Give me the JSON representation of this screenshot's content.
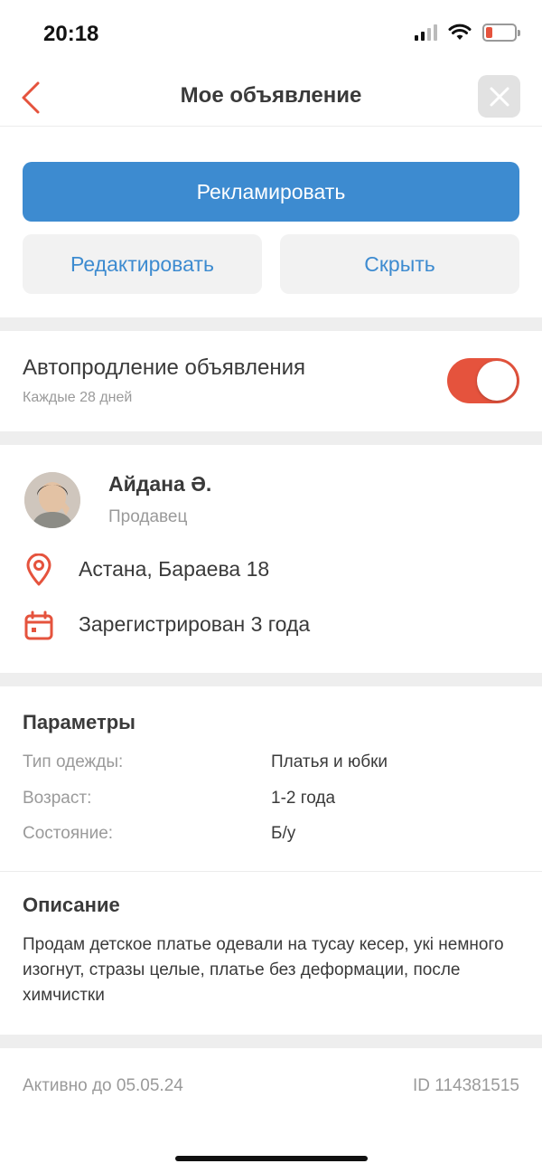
{
  "status_bar": {
    "time": "20:18"
  },
  "nav": {
    "title": "Мое объявление"
  },
  "actions": {
    "promote_label": "Рекламировать",
    "edit_label": "Редактировать",
    "hide_label": "Скрыть"
  },
  "autorenew": {
    "title": "Автопродление объявления",
    "subtitle": "Каждые 28 дней",
    "enabled": true
  },
  "seller": {
    "name": "Айдана Ә.",
    "role": "Продавец",
    "location": "Астана, Бараева 18",
    "registered": "Зарегистрирован 3 года"
  },
  "parameters": {
    "title": "Параметры",
    "rows": [
      {
        "label": "Тип одежды:",
        "value": "Платья и юбки"
      },
      {
        "label": "Возраст:",
        "value": "1-2 года"
      },
      {
        "label": "Состояние:",
        "value": "Б/у"
      }
    ]
  },
  "description": {
    "title": "Описание",
    "text": "Продам детское платье одевали на тусау кесер, укі немного изогнут, стразы целые, платье без деформации, после химчистки"
  },
  "footer": {
    "active_until": "Активно до 05.05.24",
    "id": "ID 114381515"
  },
  "colors": {
    "accent_red": "#e5533d",
    "accent_blue": "#3d8bd0",
    "band_gray": "#eeeeee"
  }
}
